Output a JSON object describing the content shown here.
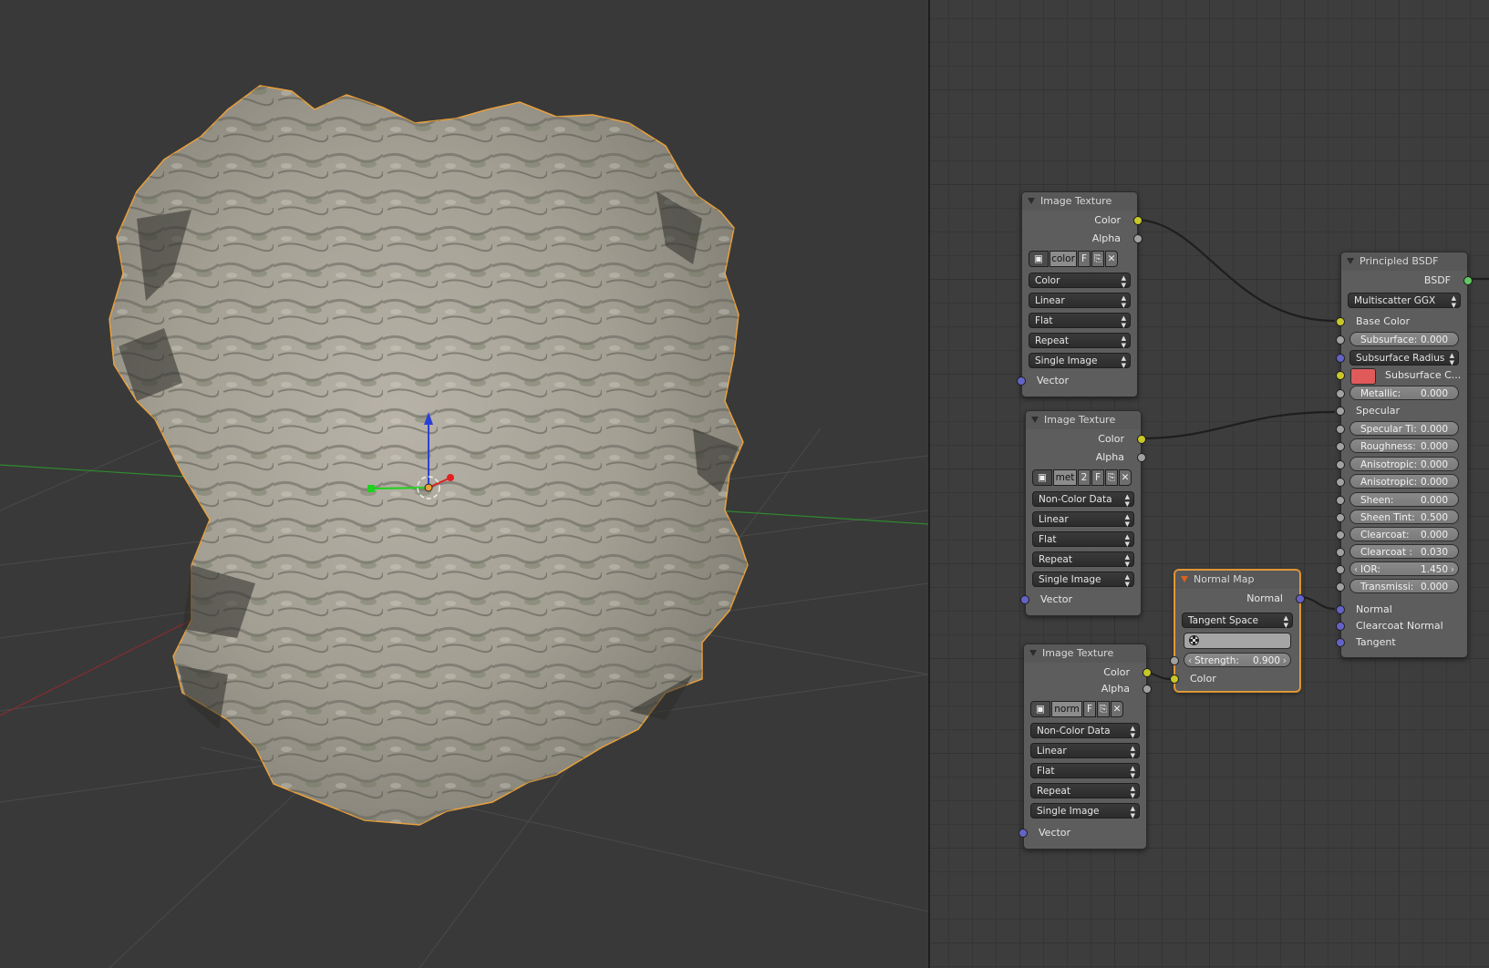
{
  "colors": {
    "socket_color": "#c7c729",
    "socket_float": "#a1a1a1",
    "socket_vector": "#6363c7",
    "socket_shader": "#63c763",
    "selection_outline": "#e8a03c",
    "subsurface_color": "#e05a5a"
  },
  "image_texture_1": {
    "title": "Image Texture",
    "out_color": "Color",
    "out_alpha": "Alpha",
    "image_name": "color",
    "image_users": "",
    "fake_user": "F",
    "color_space": "Color",
    "interpolation": "Linear",
    "projection": "Flat",
    "extension": "Repeat",
    "source": "Single Image",
    "in_vector": "Vector"
  },
  "image_texture_2": {
    "title": "Image Texture",
    "out_color": "Color",
    "out_alpha": "Alpha",
    "image_name": "met",
    "image_users": "2",
    "fake_user": "F",
    "color_space": "Non-Color Data",
    "interpolation": "Linear",
    "projection": "Flat",
    "extension": "Repeat",
    "source": "Single Image",
    "in_vector": "Vector"
  },
  "image_texture_3": {
    "title": "Image Texture",
    "out_color": "Color",
    "out_alpha": "Alpha",
    "image_name": "norm",
    "image_users": "",
    "fake_user": "F",
    "color_space": "Non-Color Data",
    "interpolation": "Linear",
    "projection": "Flat",
    "extension": "Repeat",
    "source": "Single Image",
    "in_vector": "Vector"
  },
  "normal_map": {
    "title": "Normal Map",
    "out_normal": "Normal",
    "space": "Tangent Space",
    "uv_map": "",
    "strength_label": "Strength:",
    "strength_value": "0.900",
    "in_color": "Color"
  },
  "principled_bsdf": {
    "title": "Principled BSDF",
    "out_bsdf": "BSDF",
    "distribution": "Multiscatter GGX",
    "base_color": "Base Color",
    "subsurface_label": "Subsurface:",
    "subsurface_value": "0.000",
    "subsurface_radius": "Subsurface Radius",
    "subsurface_color": "Subsurface C...",
    "metallic_label": "Metallic:",
    "metallic_value": "0.000",
    "specular": "Specular",
    "specular_tint_label": "Specular Ti:",
    "specular_tint_value": "0.000",
    "roughness_label": "Roughness:",
    "roughness_value": "0.000",
    "anisotropic_label": "Anisotropic:",
    "anisotropic_value": "0.000",
    "anisotropic_rot_label": "Anisotropic:",
    "anisotropic_rot_value": "0.000",
    "sheen_label": "Sheen:",
    "sheen_value": "0.000",
    "sheen_tint_label": "Sheen Tint:",
    "sheen_tint_value": "0.500",
    "clearcoat_label": "Clearcoat:",
    "clearcoat_value": "0.000",
    "clearcoat_rough_label": "Clearcoat :",
    "clearcoat_rough_value": "0.030",
    "ior_label": "IOR:",
    "ior_value": "1.450",
    "transmission_label": "Transmissi:",
    "transmission_value": "0.000",
    "normal": "Normal",
    "clearcoat_normal": "Clearcoat Normal",
    "tangent": "Tangent"
  }
}
